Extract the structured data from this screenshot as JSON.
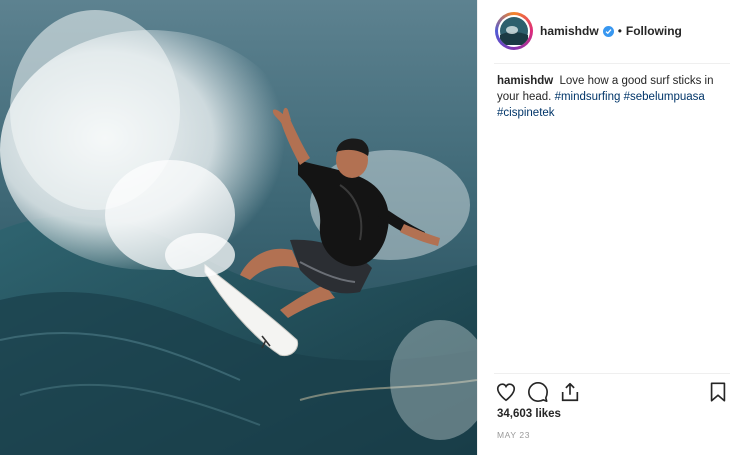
{
  "post": {
    "author": {
      "username": "hamishdw",
      "verified": true,
      "separator": "•",
      "follow_status": "Following"
    },
    "photo": {
      "subject": "surfer carving a wave",
      "accent_colors": [
        "#2f5a68",
        "#1f4552",
        "#e9eef0",
        "#1c1c1c",
        "#b27152"
      ]
    },
    "caption": {
      "username": "hamishdw",
      "text": "Love how a good surf sticks in your head.",
      "hashtags": [
        "#mindsurfing",
        "#sebelumpuasa",
        "#cispinetek"
      ]
    },
    "actions": {
      "like_icon": "heart-icon",
      "comment_icon": "comment-icon",
      "share_icon": "share-icon",
      "save_icon": "bookmark-icon"
    },
    "likes_text": "34,603 likes",
    "date": "MAY 23"
  }
}
